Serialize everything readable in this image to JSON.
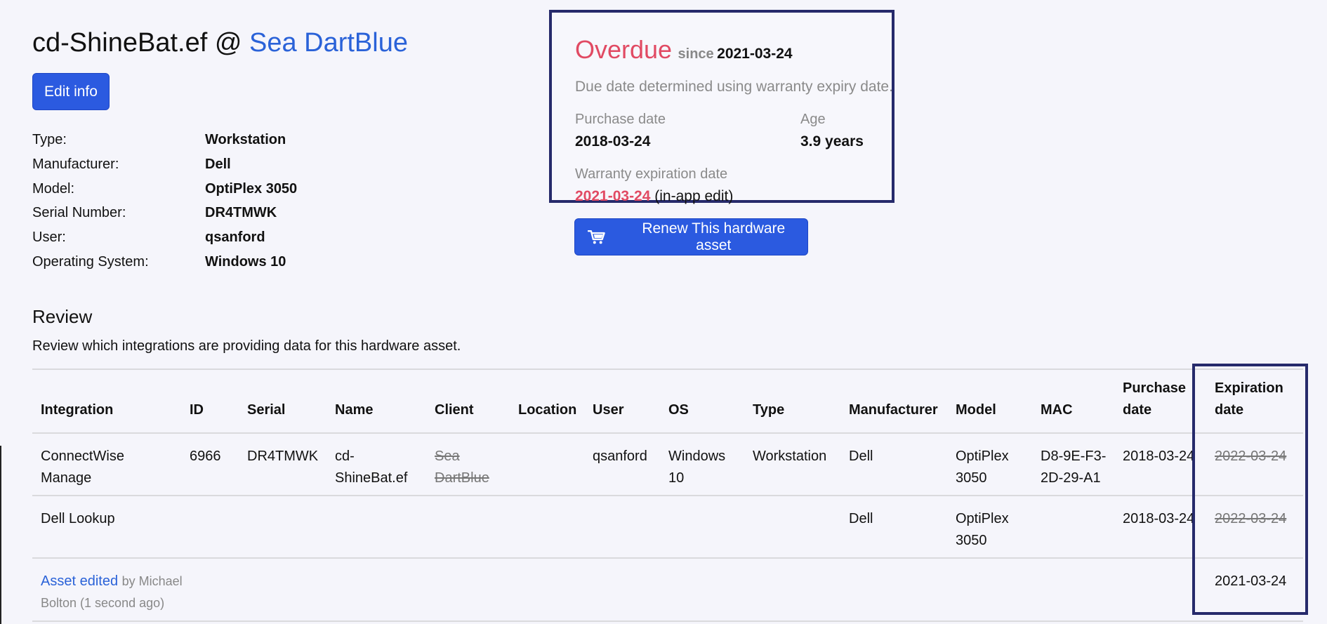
{
  "asset": {
    "name": "cd-ShineBat.ef",
    "at": "@",
    "client": "Sea DartBlue"
  },
  "edit_button": "Edit info",
  "details": [
    {
      "label": "Type:",
      "value": "Workstation"
    },
    {
      "label": "Manufacturer:",
      "value": "Dell"
    },
    {
      "label": "Model:",
      "value": "OptiPlex 3050"
    },
    {
      "label": "Serial Number:",
      "value": "DR4TMWK"
    },
    {
      "label": "User:",
      "value": "qsanford"
    },
    {
      "label": "Operating System:",
      "value": "Windows 10"
    }
  ],
  "status": {
    "overdue": "Overdue",
    "since": "since",
    "since_date": "2021-03-24",
    "note": "Due date determined using warranty expiry date.",
    "purchase_label": "Purchase date",
    "purchase_value": "2018-03-24",
    "age_label": "Age",
    "age_value": "3.9 years",
    "warranty_label": "Warranty expiration date",
    "warranty_value": "2021-03-24",
    "warranty_suffix": "(in-app edit)",
    "accent": "#e14a63"
  },
  "renew_button": "Renew This hardware asset",
  "review": {
    "title": "Review",
    "description": "Review which integrations are providing data for this hardware asset.",
    "headers": {
      "integration": "Integration",
      "id": "ID",
      "serial": "Serial",
      "name": "Name",
      "client": "Client",
      "location": "Location",
      "user": "User",
      "os": "OS",
      "type": "Type",
      "manufacturer": "Manufacturer",
      "model": "Model",
      "mac": "MAC",
      "purchase_line1": "Purchase",
      "purchase_line2": "date",
      "expiration_line1": "Expiration",
      "expiration_line2": "date"
    },
    "rows": [
      {
        "integration_line1": "ConnectWise",
        "integration_line2": "Manage",
        "id": "6966",
        "serial": "DR4TMWK",
        "name_line1": "cd-",
        "name_line2": "ShineBat.ef",
        "client_line1": "Sea",
        "client_line2": "DartBlue",
        "location": "",
        "user": "qsanford",
        "os_line1": "Windows",
        "os_line2": "10",
        "type": "Workstation",
        "manufacturer": "Dell",
        "model_line1": "OptiPlex",
        "model_line2": "3050",
        "mac_line1": "D8-9E-F3-",
        "mac_line2": "2D-29-A1",
        "purchase": "2018-03-24",
        "expiration": "2022-03-24"
      },
      {
        "integration_line1": "Dell Lookup",
        "manufacturer": "Dell",
        "model_line1": "OptiPlex",
        "model_line2": "3050",
        "purchase": "2018-03-24",
        "expiration": "2022-03-24"
      }
    ],
    "edit_row": {
      "link": "Asset edited",
      "by_line1": "by Michael",
      "by_line2": "Bolton (1 second ago)",
      "expiration": "2021-03-24"
    }
  }
}
